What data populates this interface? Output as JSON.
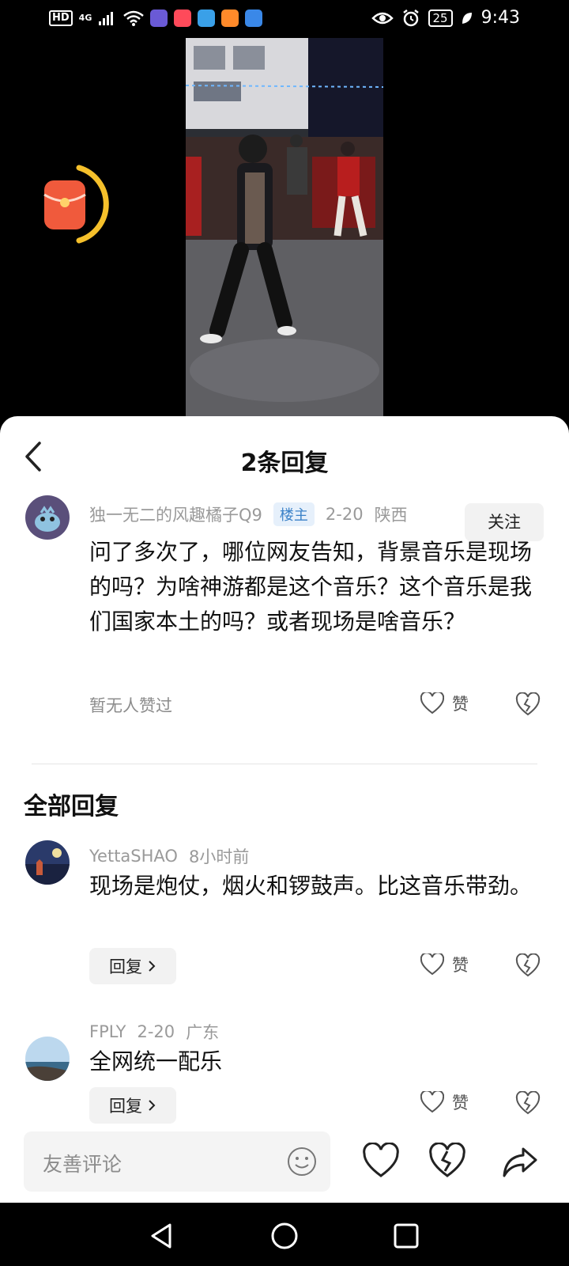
{
  "status_bar": {
    "hd": "HD",
    "network": "4G",
    "battery": "25",
    "time": "9:43",
    "app_colors": [
      "#6a5ad6",
      "#ff4a5a",
      "#3aa0e8",
      "#ff8a2a",
      "#3a88e8"
    ]
  },
  "sheet": {
    "title": "2条回复"
  },
  "main_comment": {
    "username": "独一无二的风趣橘子Q9",
    "badge": "楼主",
    "date": "2-20",
    "location": "陕西",
    "follow": "关注",
    "text": "问了多次了，哪位网友告知，背景音乐是现场的吗？为啥神游都是这个音乐？这个音乐是我们国家本土的吗？或者现场是啥音乐？",
    "likes_status": "暂无人赞过",
    "like_label": "赞"
  },
  "section_title": "全部回复",
  "replies": [
    {
      "username": "YettaSHAO",
      "time": "8小时前",
      "text": "现场是炮仗，烟火和锣鼓声。比这音乐带劲。",
      "reply_label": "回复",
      "like_label": "赞"
    },
    {
      "username": "FPLY",
      "time": "2-20",
      "location": "广东",
      "text": "全网统一配乐",
      "reply_label": "回复",
      "like_label": "赞"
    }
  ],
  "input_bar": {
    "placeholder": "友善评论"
  },
  "icons": {
    "back": "back-icon",
    "heart": "heart-icon",
    "broken_heart": "broken-heart-icon",
    "share": "share-icon",
    "emoji": "emoji-icon",
    "red_packet": "red-packet-icon"
  },
  "colors": {
    "accent_blue": "#3b82c8",
    "red_packet": "#f05a3c",
    "ring": "#f5c02b"
  }
}
